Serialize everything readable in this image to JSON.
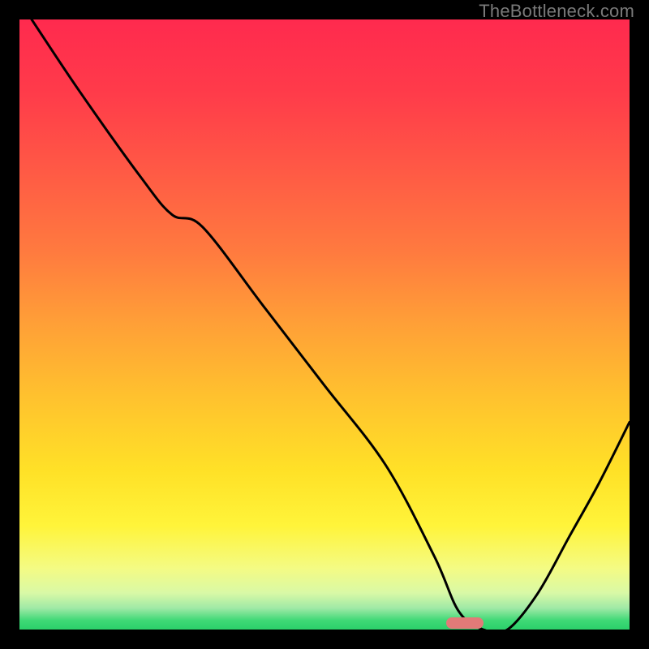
{
  "watermark": "TheBottleneck.com",
  "marker": {
    "x_percent": 73,
    "y_percent": 99.0,
    "color": "#e27a78"
  },
  "gradient_stops": [
    {
      "offset": 0.0,
      "color": "#ff2a4e"
    },
    {
      "offset": 0.12,
      "color": "#ff3b4a"
    },
    {
      "offset": 0.25,
      "color": "#ff5a45"
    },
    {
      "offset": 0.38,
      "color": "#ff7a3f"
    },
    {
      "offset": 0.5,
      "color": "#ffa037"
    },
    {
      "offset": 0.62,
      "color": "#ffc22e"
    },
    {
      "offset": 0.74,
      "color": "#ffe127"
    },
    {
      "offset": 0.83,
      "color": "#fff43a"
    },
    {
      "offset": 0.9,
      "color": "#f4fb84"
    },
    {
      "offset": 0.94,
      "color": "#d9f9a6"
    },
    {
      "offset": 0.965,
      "color": "#9fe9a6"
    },
    {
      "offset": 0.985,
      "color": "#3fd976"
    },
    {
      "offset": 1.0,
      "color": "#2bd06a"
    }
  ],
  "chart_data": {
    "type": "line",
    "title": "",
    "xlabel": "",
    "ylabel": "",
    "xlim": [
      0,
      100
    ],
    "ylim": [
      0,
      100
    ],
    "series": [
      {
        "name": "bottleneck-curve",
        "x": [
          2,
          10,
          20,
          25,
          30,
          40,
          50,
          60,
          68,
          72,
          76,
          80,
          85,
          90,
          95,
          100
        ],
        "y": [
          100,
          88,
          74,
          68,
          66,
          53,
          40,
          27,
          12,
          3,
          0,
          0,
          6,
          15,
          24,
          34
        ]
      }
    ],
    "annotations": [
      {
        "text": "TheBottleneck.com",
        "role": "watermark",
        "position": "top-right"
      }
    ]
  }
}
